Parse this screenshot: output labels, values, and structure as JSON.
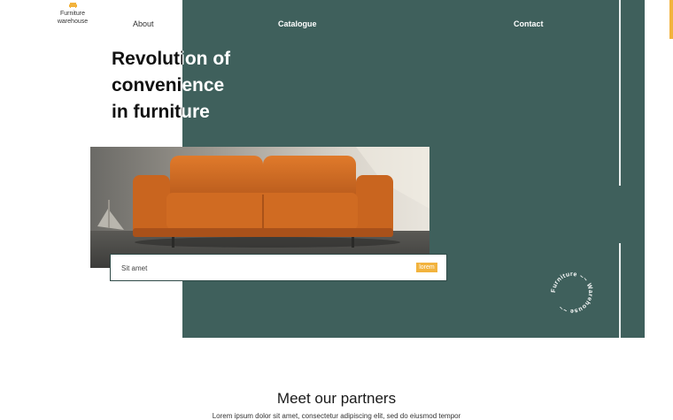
{
  "logo": {
    "text_line1": "Furniture",
    "text_line2": "warehouse"
  },
  "nav": {
    "about": "About",
    "catalogue": "Catalogue",
    "contact": "Contact"
  },
  "hero": {
    "line1": "Revolution of",
    "line2": "convenience",
    "line3": "in furniture"
  },
  "search": {
    "placeholder": "Sit amet",
    "button_label": "lorem"
  },
  "stamp": {
    "text": "Furniture ~~ Warehouse ~~"
  },
  "partners": {
    "title": "Meet our partners",
    "subtitle": "Lorem ipsum dolor sit amet, consectetur adipiscing elit, sed do eiusmod tempor"
  },
  "colors": {
    "panel": "#3f605c",
    "accent": "#f2b33d",
    "sofa": "#c8641e"
  }
}
